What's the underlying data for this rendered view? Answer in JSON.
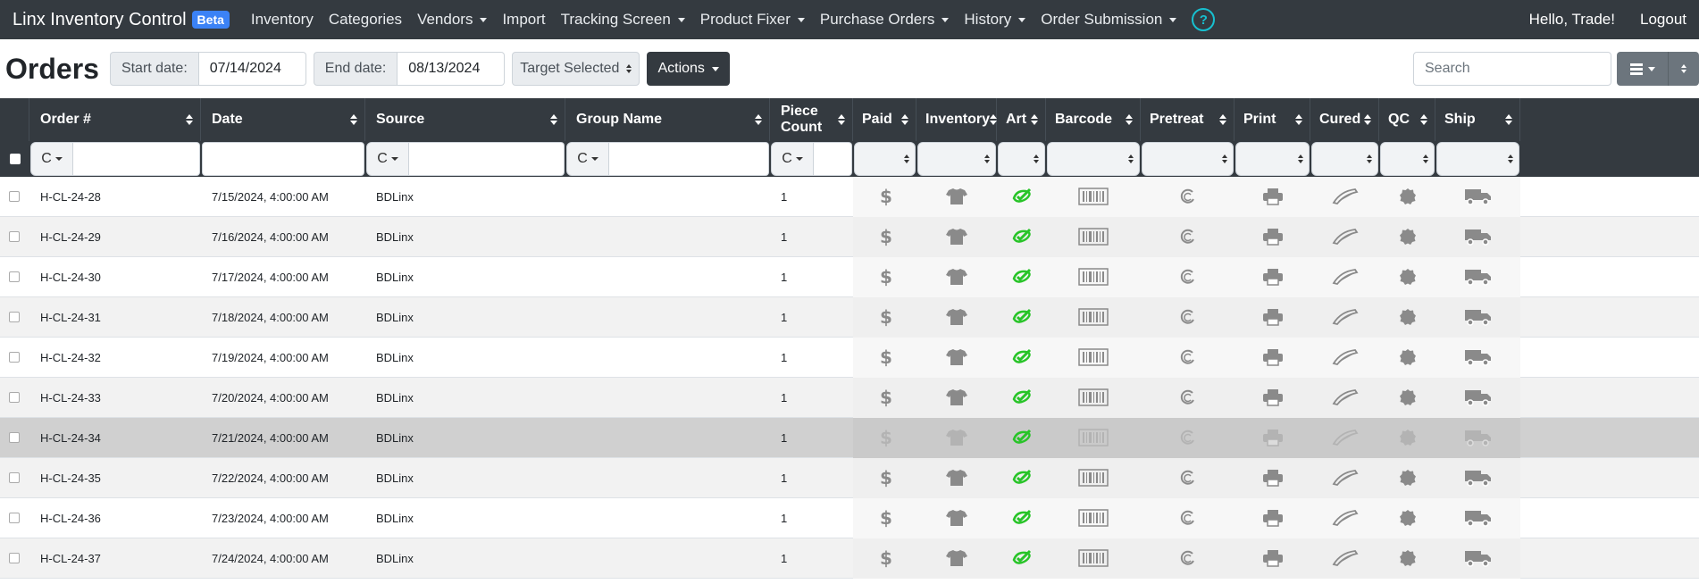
{
  "nav": {
    "brand": "Linx Inventory Control",
    "beta": "Beta",
    "items": [
      {
        "label": "Inventory",
        "dropdown": false
      },
      {
        "label": "Categories",
        "dropdown": false
      },
      {
        "label": "Vendors",
        "dropdown": true
      },
      {
        "label": "Import",
        "dropdown": false
      },
      {
        "label": "Tracking Screen",
        "dropdown": true
      },
      {
        "label": "Product Fixer",
        "dropdown": true
      },
      {
        "label": "Purchase Orders",
        "dropdown": true
      },
      {
        "label": "History",
        "dropdown": true
      },
      {
        "label": "Order Submission",
        "dropdown": true
      }
    ],
    "help": "?",
    "greeting": "Hello, Trade!",
    "logout": "Logout"
  },
  "toolbar": {
    "title": "Orders",
    "start_label": "Start date:",
    "start_value": "07/14/2024",
    "end_label": "End date:",
    "end_value": "08/13/2024",
    "target": "Target Selected",
    "actions": "Actions",
    "search_placeholder": "Search"
  },
  "columns": [
    {
      "label": "Order #"
    },
    {
      "label": "Date"
    },
    {
      "label": "Source"
    },
    {
      "label": "Group Name"
    },
    {
      "label": "Piece Count"
    },
    {
      "label": "Paid"
    },
    {
      "label": "Inventory"
    },
    {
      "label": "Art"
    },
    {
      "label": "Barcode"
    },
    {
      "label": "Pretreat"
    },
    {
      "label": "Print"
    },
    {
      "label": "Cured"
    },
    {
      "label": "QC"
    },
    {
      "label": "Ship"
    }
  ],
  "filter_button": "C",
  "colors": {
    "navbar": "#343a40",
    "beta": "#3b82f6",
    "art_green": "#28c428",
    "icon_grey": "#8a8a8a",
    "help": "#17c0d0"
  },
  "rows": [
    {
      "order": "H-CL-24-28",
      "date": "7/15/2024, 4:00:00 AM",
      "source": "BDLinx",
      "group": "",
      "count": "1",
      "selected": false
    },
    {
      "order": "H-CL-24-29",
      "date": "7/16/2024, 4:00:00 AM",
      "source": "BDLinx",
      "group": "",
      "count": "1",
      "selected": false
    },
    {
      "order": "H-CL-24-30",
      "date": "7/17/2024, 4:00:00 AM",
      "source": "BDLinx",
      "group": "",
      "count": "1",
      "selected": false
    },
    {
      "order": "H-CL-24-31",
      "date": "7/18/2024, 4:00:00 AM",
      "source": "BDLinx",
      "group": "",
      "count": "1",
      "selected": false
    },
    {
      "order": "H-CL-24-32",
      "date": "7/19/2024, 4:00:00 AM",
      "source": "BDLinx",
      "group": "",
      "count": "1",
      "selected": false
    },
    {
      "order": "H-CL-24-33",
      "date": "7/20/2024, 4:00:00 AM",
      "source": "BDLinx",
      "group": "",
      "count": "1",
      "selected": false
    },
    {
      "order": "H-CL-24-34",
      "date": "7/21/2024, 4:00:00 AM",
      "source": "BDLinx",
      "group": "",
      "count": "1",
      "selected": true
    },
    {
      "order": "H-CL-24-35",
      "date": "7/22/2024, 4:00:00 AM",
      "source": "BDLinx",
      "group": "",
      "count": "1",
      "selected": false
    },
    {
      "order": "H-CL-24-36",
      "date": "7/23/2024, 4:00:00 AM",
      "source": "BDLinx",
      "group": "",
      "count": "1",
      "selected": false
    },
    {
      "order": "H-CL-24-37",
      "date": "7/24/2024, 4:00:00 AM",
      "source": "BDLinx",
      "group": "",
      "count": "1",
      "selected": false
    }
  ],
  "status_icons": [
    "dollar-icon",
    "tshirt-icon",
    "art-check-icon",
    "barcode-icon",
    "pretreat-icon",
    "print-icon",
    "cured-icon",
    "qc-badge-icon",
    "truck-icon"
  ]
}
